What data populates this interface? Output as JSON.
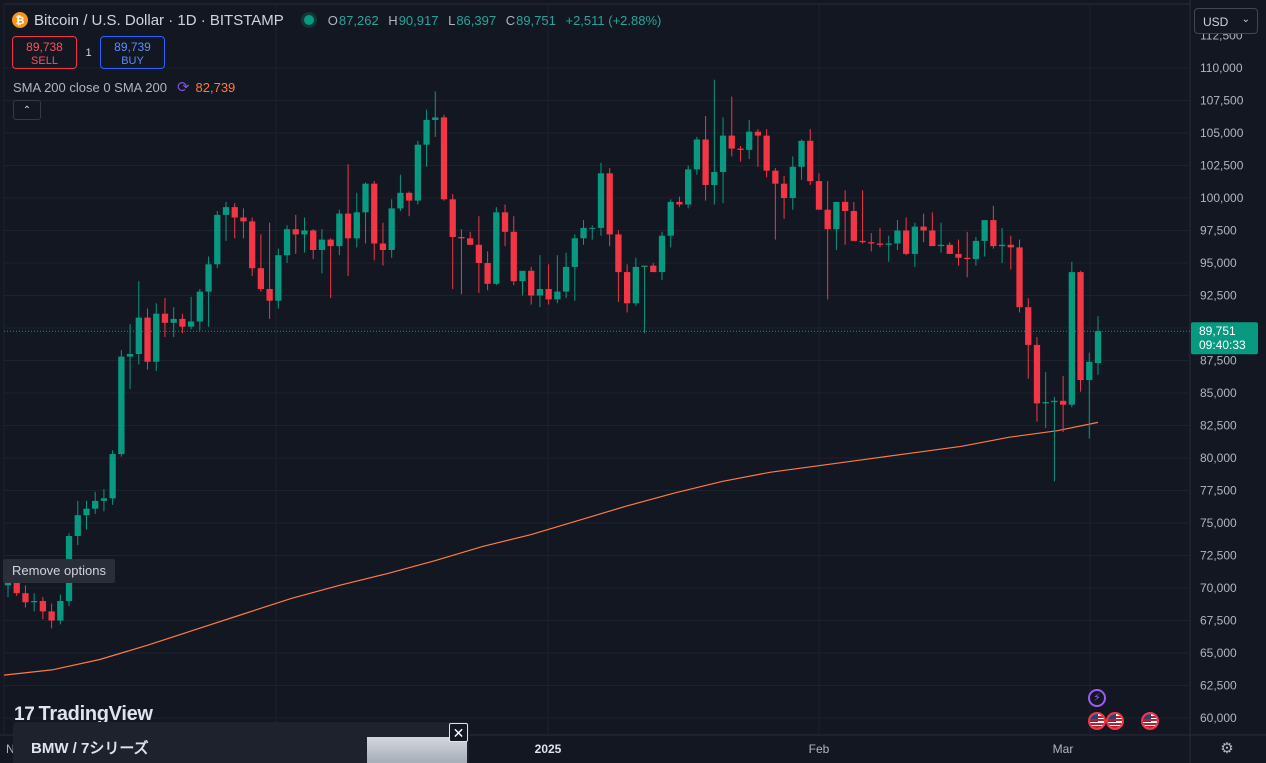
{
  "header": {
    "coin_glyph": "₿",
    "symbol_title": "Bitcoin / U.S. Dollar · 1D · BITSTAMP",
    "ohlc": {
      "o_label": "O",
      "o": "87,262",
      "h_label": "H",
      "h": "90,917",
      "l_label": "L",
      "l": "86,397",
      "c_label": "C",
      "c": "89,751",
      "change": "+2,511 (+2.88%)"
    }
  },
  "trade": {
    "sell_price": "89,738",
    "sell_label": "SELL",
    "spread": "1",
    "buy_price": "89,739",
    "buy_label": "BUY"
  },
  "indicator": {
    "label": "SMA 200 close 0 SMA 200",
    "value": "82,739",
    "color": "#ff7a45"
  },
  "tooltip": "Remove options",
  "currency": "USD",
  "last_price": {
    "price": "89,751",
    "countdown": "09:40:33",
    "color": "#089981"
  },
  "price_axis_labels": [
    "112,500",
    "110,000",
    "107,500",
    "105,000",
    "102,500",
    "100,000",
    "97,500",
    "95,000",
    "92,500",
    "90,000",
    "87,500",
    "85,000",
    "82,500",
    "80,000",
    "77,500",
    "75,000",
    "72,500",
    "70,000",
    "67,500",
    "65,000",
    "62,500",
    "60,000"
  ],
  "time_axis_labels": [
    "N",
    "2025",
    "Feb",
    "Mar"
  ],
  "logo_text": "TradingView",
  "ad": {
    "title": "BMW / 7シリーズ"
  },
  "icons": {
    "collapse": "chevron-up-icon",
    "ad_close": "close-icon",
    "settings": "gear-icon",
    "events": [
      "lightning-icon",
      "us-flag-icon",
      "us-flag-icon",
      "us-flag-icon"
    ]
  },
  "colors": {
    "up": "#089981",
    "down": "#f23645",
    "background": "#131722",
    "sma": "#ff7a45"
  },
  "chart_data": {
    "type": "candlestick",
    "title": "Bitcoin / U.S. Dollar · 1D · BITSTAMP",
    "y_range": [
      59000,
      113000
    ],
    "x_ticks": [
      "2025",
      "Feb",
      "Mar"
    ],
    "last_close": 89751,
    "candles": [
      [
        70200,
        71800,
        69300,
        70500
      ],
      [
        70500,
        71200,
        69400,
        69600
      ],
      [
        69600,
        70200,
        68500,
        68900
      ],
      [
        68900,
        69600,
        68200,
        69000
      ],
      [
        69000,
        69300,
        67600,
        68200
      ],
      [
        68200,
        68800,
        66900,
        67500
      ],
      [
        67500,
        69500,
        67200,
        69000
      ],
      [
        69000,
        74200,
        68600,
        74000
      ],
      [
        74000,
        76700,
        73300,
        75600
      ],
      [
        75600,
        76700,
        74500,
        76100
      ],
      [
        76100,
        77400,
        75700,
        76700
      ],
      [
        76700,
        77600,
        75900,
        76900
      ],
      [
        76900,
        80600,
        76400,
        80300
      ],
      [
        80300,
        88300,
        80100,
        87800
      ],
      [
        87800,
        90300,
        85300,
        88000
      ],
      [
        88000,
        93600,
        87200,
        90800
      ],
      [
        90800,
        91500,
        86800,
        87400
      ],
      [
        87400,
        91900,
        86700,
        91100
      ],
      [
        91100,
        92300,
        89300,
        90400
      ],
      [
        90400,
        91600,
        89300,
        90700
      ],
      [
        90700,
        91100,
        89600,
        90100
      ],
      [
        90100,
        92400,
        89900,
        90500
      ],
      [
        90500,
        93000,
        89800,
        92800
      ],
      [
        92800,
        95500,
        90100,
        94900
      ],
      [
        94900,
        99000,
        94600,
        98700
      ],
      [
        98700,
        99700,
        96700,
        99300
      ],
      [
        99300,
        99600,
        96900,
        98500
      ],
      [
        98500,
        99200,
        96900,
        98200
      ],
      [
        98200,
        98500,
        94000,
        94600
      ],
      [
        94600,
        97200,
        92800,
        93000
      ],
      [
        93000,
        98100,
        90700,
        92100
      ],
      [
        92100,
        96100,
        91500,
        95600
      ],
      [
        95600,
        97900,
        95000,
        97600
      ],
      [
        97600,
        98700,
        95700,
        97200
      ],
      [
        97200,
        98500,
        95800,
        97500
      ],
      [
        97500,
        97600,
        95300,
        96000
      ],
      [
        96000,
        97600,
        94200,
        96800
      ],
      [
        96800,
        96900,
        92300,
        96300
      ],
      [
        96300,
        99100,
        95600,
        98800
      ],
      [
        98800,
        102600,
        94000,
        96900
      ],
      [
        96900,
        100400,
        96200,
        98900
      ],
      [
        98900,
        101200,
        96500,
        101100
      ],
      [
        101100,
        101300,
        95200,
        96500
      ],
      [
        96500,
        98100,
        94800,
        96000
      ],
      [
        96000,
        99900,
        95400,
        99200
      ],
      [
        99200,
        101800,
        99000,
        100400
      ],
      [
        100400,
        100500,
        98600,
        99800
      ],
      [
        99800,
        104400,
        99500,
        104100
      ],
      [
        104100,
        106800,
        102400,
        106000
      ],
      [
        106000,
        108200,
        104700,
        106200
      ],
      [
        106200,
        106400,
        99800,
        99900
      ],
      [
        99900,
        100300,
        93000,
        97000
      ],
      [
        97000,
        97600,
        92600,
        96900
      ],
      [
        96900,
        97400,
        96400,
        96400
      ],
      [
        96400,
        98600,
        92700,
        95000
      ],
      [
        95000,
        95900,
        92900,
        93400
      ],
      [
        93400,
        99300,
        93300,
        98900
      ],
      [
        98900,
        99500,
        96300,
        97400
      ],
      [
        97400,
        98600,
        93300,
        93600
      ],
      [
        93600,
        94300,
        92500,
        94400
      ],
      [
        94400,
        94700,
        91800,
        92500
      ],
      [
        92500,
        95600,
        91600,
        93000
      ],
      [
        93000,
        94900,
        91800,
        92200
      ],
      [
        92200,
        95600,
        91900,
        92800
      ],
      [
        92800,
        95800,
        92300,
        94700
      ],
      [
        94700,
        97200,
        92100,
        96900
      ],
      [
        96900,
        98300,
        96400,
        97700
      ],
      [
        97700,
        97900,
        96800,
        97700
      ],
      [
        97700,
        102700,
        97100,
        101900
      ],
      [
        101900,
        102300,
        96300,
        97200
      ],
      [
        97200,
        97500,
        92000,
        94300
      ],
      [
        94300,
        94900,
        91200,
        91900
      ],
      [
        91900,
        95400,
        91700,
        94700
      ],
      [
        94700,
        94800,
        89600,
        94800
      ],
      [
        94800,
        95000,
        94300,
        94300
      ],
      [
        94300,
        97400,
        93700,
        97100
      ],
      [
        97100,
        99900,
        96200,
        99700
      ],
      [
        99700,
        100100,
        99300,
        99500
      ],
      [
        99500,
        102500,
        99200,
        102200
      ],
      [
        102200,
        104700,
        101800,
        104500
      ],
      [
        104500,
        106300,
        99800,
        101000
      ],
      [
        101000,
        109100,
        99500,
        102000
      ],
      [
        102000,
        106200,
        99600,
        104800
      ],
      [
        104800,
        107800,
        103200,
        103800
      ],
      [
        103800,
        104000,
        102800,
        103700
      ],
      [
        103700,
        106000,
        103000,
        105100
      ],
      [
        105100,
        105300,
        102400,
        104800
      ],
      [
        104800,
        105300,
        101600,
        102100
      ],
      [
        102100,
        102300,
        96800,
        101100
      ],
      [
        101100,
        101700,
        98400,
        100000
      ],
      [
        100000,
        103200,
        99100,
        102400
      ],
      [
        102400,
        104500,
        101400,
        104400
      ],
      [
        104400,
        105300,
        101000,
        101300
      ],
      [
        101300,
        101900,
        99400,
        99100
      ],
      [
        99100,
        101300,
        92200,
        97600
      ],
      [
        97600,
        98800,
        96000,
        99700
      ],
      [
        99700,
        100600,
        96400,
        99000
      ],
      [
        99000,
        99700,
        97600,
        96700
      ],
      [
        96700,
        100600,
        96500,
        96600
      ],
      [
        96600,
        97300,
        95900,
        96500
      ],
      [
        96500,
        97700,
        96200,
        96400
      ],
      [
        96400,
        97100,
        95100,
        96500
      ],
      [
        96500,
        98300,
        96000,
        97500
      ],
      [
        97500,
        98500,
        95600,
        95700
      ],
      [
        95700,
        98100,
        94700,
        97800
      ],
      [
        97800,
        98800,
        96600,
        97500
      ],
      [
        97500,
        98900,
        96400,
        96300
      ],
      [
        96300,
        98100,
        95800,
        96400
      ],
      [
        96400,
        96600,
        95700,
        95700
      ],
      [
        95700,
        96800,
        94800,
        95400
      ],
      [
        95400,
        97400,
        93900,
        95300
      ],
      [
        95300,
        97000,
        94800,
        96700
      ],
      [
        96700,
        97500,
        95500,
        98300
      ],
      [
        98300,
        99400,
        96100,
        96300
      ],
      [
        96300,
        97700,
        95000,
        96400
      ],
      [
        96400,
        97100,
        94500,
        96200
      ],
      [
        96200,
        96800,
        91200,
        91600
      ],
      [
        91600,
        92300,
        86100,
        88700
      ],
      [
        88700,
        89300,
        82800,
        84200
      ],
      [
        84200,
        86600,
        82300,
        84300
      ],
      [
        84300,
        84700,
        78200,
        84400
      ],
      [
        84400,
        86300,
        82000,
        84100
      ],
      [
        84100,
        95100,
        83900,
        94300
      ],
      [
        94300,
        94400,
        85100,
        86000
      ],
      [
        86000,
        88100,
        81500,
        87400
      ],
      [
        87300,
        90900,
        86400,
        89751
      ]
    ],
    "sma200": [
      [
        0,
        63300
      ],
      [
        20,
        63700
      ],
      [
        40,
        64500
      ],
      [
        60,
        65600
      ],
      [
        80,
        66800
      ],
      [
        100,
        68000
      ],
      [
        120,
        69200
      ],
      [
        140,
        70200
      ],
      [
        160,
        71100
      ],
      [
        180,
        72100
      ],
      [
        200,
        73200
      ],
      [
        220,
        74100
      ],
      [
        240,
        75200
      ],
      [
        260,
        76300
      ],
      [
        280,
        77300
      ],
      [
        300,
        78200
      ],
      [
        320,
        78900
      ],
      [
        340,
        79400
      ],
      [
        360,
        79900
      ],
      [
        380,
        80400
      ],
      [
        400,
        80900
      ],
      [
        420,
        81600
      ],
      [
        440,
        82100
      ],
      [
        457,
        82739
      ]
    ],
    "sma200_x_count": 457
  }
}
